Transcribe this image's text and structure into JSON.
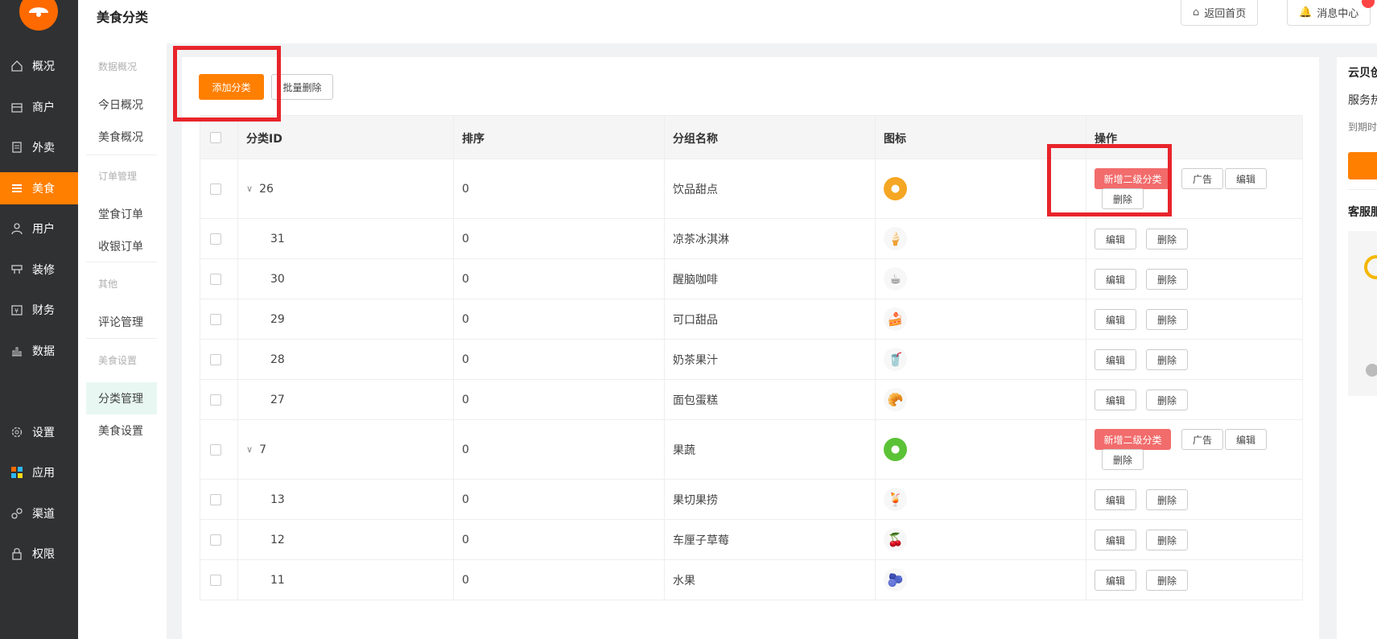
{
  "sidebar": {
    "items": [
      {
        "label": "概况",
        "icon": "home-icon"
      },
      {
        "label": "商户",
        "icon": "store-icon"
      },
      {
        "label": "外卖",
        "icon": "document-icon"
      },
      {
        "label": "美食",
        "icon": "menu-icon"
      },
      {
        "label": "用户",
        "icon": "user-icon"
      },
      {
        "label": "装修",
        "icon": "decorate-icon"
      },
      {
        "label": "财务",
        "icon": "finance-icon"
      },
      {
        "label": "数据",
        "icon": "chart-icon"
      },
      {
        "label": "设置",
        "icon": "gear-icon"
      },
      {
        "label": "应用",
        "icon": "apps-icon"
      },
      {
        "label": "渠道",
        "icon": "channel-icon"
      },
      {
        "label": "权限",
        "icon": "lock-icon"
      }
    ],
    "active_color": "#ff7f00"
  },
  "subnav": {
    "groups": [
      "数据概况",
      "订单管理",
      "其他",
      "美食设置"
    ],
    "items": [
      "今日概况",
      "美食概况",
      "堂食订单",
      "收银订单",
      "评论管理",
      "分类管理",
      "美食设置"
    ]
  },
  "header": {
    "title": "美食分类",
    "home_btn": "返回首页",
    "msg_btn": "消息中心"
  },
  "toolbar": {
    "add_label": "添加分类",
    "batch_delete_label": "批量删除"
  },
  "table": {
    "headers": [
      "分类ID",
      "排序",
      "分组名称",
      "图标",
      "操作"
    ],
    "rows": [
      {
        "id": "26",
        "sort": "0",
        "name": "饮品甜点",
        "parent": true,
        "icon_color": "#f5a623"
      },
      {
        "id": "31",
        "sort": "0",
        "name": "凉茶冰淇淋",
        "parent": false,
        "icon": "icecream"
      },
      {
        "id": "30",
        "sort": "0",
        "name": "醒脑咖啡",
        "parent": false,
        "icon": "coffee"
      },
      {
        "id": "29",
        "sort": "0",
        "name": "可口甜品",
        "parent": false,
        "icon": "dessert"
      },
      {
        "id": "28",
        "sort": "0",
        "name": "奶茶果汁",
        "parent": false,
        "icon": "milktea"
      },
      {
        "id": "27",
        "sort": "0",
        "name": "面包蛋糕",
        "parent": false,
        "icon": "bread"
      },
      {
        "id": "7",
        "sort": "0",
        "name": "果蔬",
        "parent": true,
        "icon_color": "#5bc236"
      },
      {
        "id": "13",
        "sort": "0",
        "name": "果切果捞",
        "parent": false,
        "icon": "fruitcup"
      },
      {
        "id": "12",
        "sort": "0",
        "name": "车厘子草莓",
        "parent": false,
        "icon": "cherry"
      },
      {
        "id": "11",
        "sort": "0",
        "name": "水果",
        "parent": false,
        "icon": "fruit"
      }
    ],
    "ops": {
      "add_sub": "新增二级分类",
      "ad": "广告",
      "edit": "编辑",
      "delete": "删除"
    }
  },
  "rpanel": {
    "title": "云贝创",
    "line1": "服务热",
    "line2": "到期时",
    "section": "客服服"
  }
}
